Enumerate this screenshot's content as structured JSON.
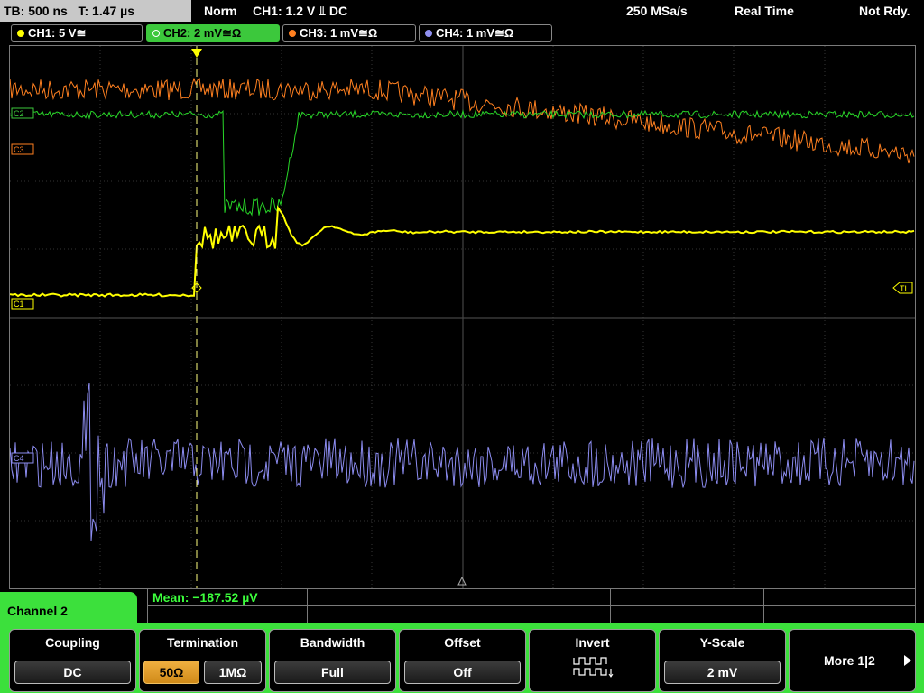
{
  "status": {
    "timebase": "TB: 500 ns",
    "trigger_time": "T: 1.47 µs",
    "mode": "Norm",
    "trigger": "CH1: 1.2 V ⫫ DC",
    "sample_rate": "250 MSa/s",
    "acq_mode": "Real Time",
    "ready": "Not Rdy."
  },
  "channels": [
    {
      "label": "CH1: 5 V≅",
      "color": "#ffff00"
    },
    {
      "label": "CH2: 2 mV≅Ω",
      "color": "#3cc83c",
      "active": true
    },
    {
      "label": "CH3: 1 mV≅Ω",
      "color": "#ff8020"
    },
    {
      "label": "CH4: 1 mV≅Ω",
      "color": "#9090f0"
    }
  ],
  "markers": {
    "ch1": "C1",
    "ch2": "C2",
    "ch3": "C3",
    "ch4": "C4",
    "trigger_level": "TL"
  },
  "measurement": "Mean: −187.52 µV",
  "menu": {
    "title": "Channel 2",
    "coupling": {
      "label": "Coupling",
      "value": "DC"
    },
    "termination": {
      "label": "Termination",
      "options": [
        "50Ω",
        "1MΩ"
      ],
      "selected": "50Ω"
    },
    "bandwidth": {
      "label": "Bandwidth",
      "value": "Full"
    },
    "offset": {
      "label": "Offset",
      "value": "Off"
    },
    "invert": {
      "label": "Invert",
      "icon": "invert-waveform-icon"
    },
    "yscale": {
      "label": "Y-Scale",
      "value": "2 mV"
    },
    "more": {
      "label": "More 1|2",
      "icon": "arrow-right-icon"
    }
  }
}
